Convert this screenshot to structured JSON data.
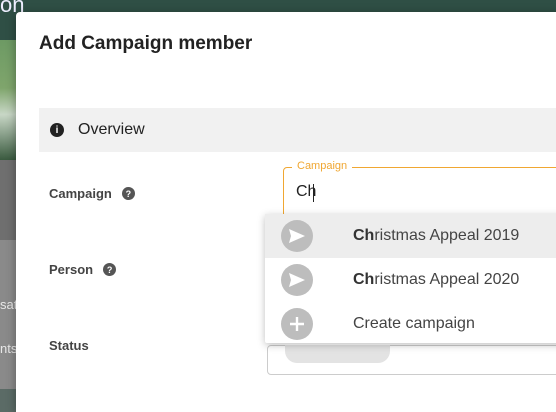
{
  "background": {
    "title_fragment": "on",
    "side_fragments": [
      "sat",
      "nts"
    ]
  },
  "modal": {
    "title": "Add Campaign member",
    "section": {
      "label": "Overview",
      "icon": "info-icon"
    },
    "fields": {
      "campaign": {
        "label": "Campaign",
        "floating_label": "Campaign",
        "value": "Ch"
      },
      "person": {
        "label": "Person"
      },
      "status": {
        "label": "Status"
      }
    },
    "dropdown": {
      "items": [
        {
          "match": "Ch",
          "rest": "ristmas Appeal 2019",
          "icon": "send-icon",
          "highlighted": true
        },
        {
          "match": "Ch",
          "rest": "ristmas Appeal 2020",
          "icon": "send-icon",
          "highlighted": false
        },
        {
          "match": "",
          "rest": "Create campaign",
          "icon": "plus-icon",
          "highlighted": false
        }
      ]
    }
  },
  "colors": {
    "accent": "#f0a732",
    "highlight": "#ededed"
  }
}
